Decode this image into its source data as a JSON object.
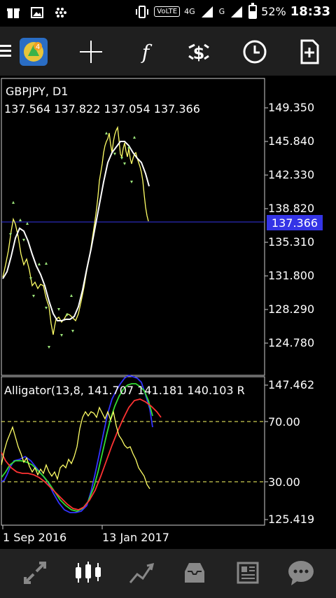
{
  "status_bar": {
    "network_generation": "4G",
    "volte_label": "VoLTE",
    "carrier_tag": "G",
    "battery_percent": "52%",
    "battery_level": 0.52,
    "time": "18:33",
    "icons": [
      "gift-icon",
      "image-icon",
      "blackberry-icon",
      "vibrate-icon",
      "volte-icon",
      "signal-icon",
      "battery-icon"
    ]
  },
  "toolbar": {
    "items": [
      "menu-icon",
      "metatrader-logo-icon",
      "crosshair-icon",
      "function-icon",
      "trade-icon",
      "clock-icon",
      "new-document-icon"
    ],
    "function_glyph": "f"
  },
  "chart": {
    "symbol_timeframe": "GBPJPY, D1",
    "ohlc": "137.564 137.822 137.054 137.366",
    "current_price": "137.366",
    "price_axis": [
      "149.350",
      "145.840",
      "142.330",
      "138.820",
      "135.310",
      "131.800",
      "128.290",
      "124.780"
    ],
    "indicator_label": "Alligator(13,8, 141.707 141.181 140.103 R",
    "indicator_axis": [
      "147.462",
      "70.00",
      "30.00",
      "125.419"
    ],
    "time_axis": [
      "1 Sep 2016",
      "13 Jan 2017"
    ],
    "colors": {
      "price_line": "#ffff66",
      "ma": "#ffffff",
      "current": "#3434e6",
      "alligator_blue": "#3333ff",
      "alligator_green": "#33dd33",
      "alligator_red": "#ff3333",
      "oscillator": "#ffff66",
      "level": "#ffff66"
    }
  },
  "bottom_bar": {
    "items": [
      "quotes-icon",
      "chart-icon",
      "trade-icon",
      "history-icon",
      "news-icon",
      "chat-icon"
    ]
  }
}
